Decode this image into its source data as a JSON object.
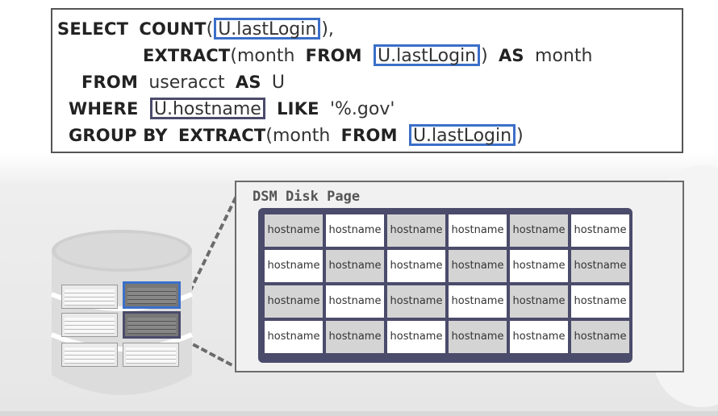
{
  "sql": {
    "line1": {
      "kw1": "SELECT",
      "kw2": "COUNT",
      "open": "(",
      "hl": "U.lastLogin",
      "close": "),"
    },
    "line2": {
      "kw1": "EXTRACT",
      "open": "(month",
      "kw2": "FROM",
      "hl": "U.lastLogin",
      "close": ")",
      "kw3": "AS",
      "rest": "month"
    },
    "line3": {
      "kw1": "FROM",
      "rest": "useracct",
      "kw2": "AS",
      "rest2": "U"
    },
    "line4": {
      "kw1": "WHERE",
      "hl": "U.hostname",
      "kw2": "LIKE",
      "rest": "'%.gov'"
    },
    "line5": {
      "kw1": "GROUP BY",
      "kw2": "EXTRACT",
      "open": "(month",
      "kw3": "FROM",
      "hl": "U.lastLogin",
      "close": ")"
    }
  },
  "panel": {
    "title": "DSM Disk Page"
  },
  "grid": {
    "cells": [
      [
        "hostname",
        "hostname",
        "hostname",
        "hostname",
        "hostname",
        "hostname"
      ],
      [
        "hostname",
        "hostname",
        "hostname",
        "hostname",
        "hostname",
        "hostname"
      ],
      [
        "hostname",
        "hostname",
        "hostname",
        "hostname",
        "hostname",
        "hostname"
      ],
      [
        "hostname",
        "hostname",
        "hostname",
        "hostname",
        "hostname",
        "hostname"
      ]
    ],
    "shading": [
      [
        1,
        0,
        1,
        0,
        1,
        0
      ],
      [
        0,
        1,
        0,
        1,
        0,
        1
      ],
      [
        1,
        0,
        1,
        0,
        1,
        0
      ],
      [
        0,
        1,
        0,
        1,
        0,
        1
      ]
    ]
  },
  "colors": {
    "highlight": "#3b6fc9",
    "highlight_dark": "#4b4b6b",
    "grid_frame": "#4b4b6b"
  }
}
